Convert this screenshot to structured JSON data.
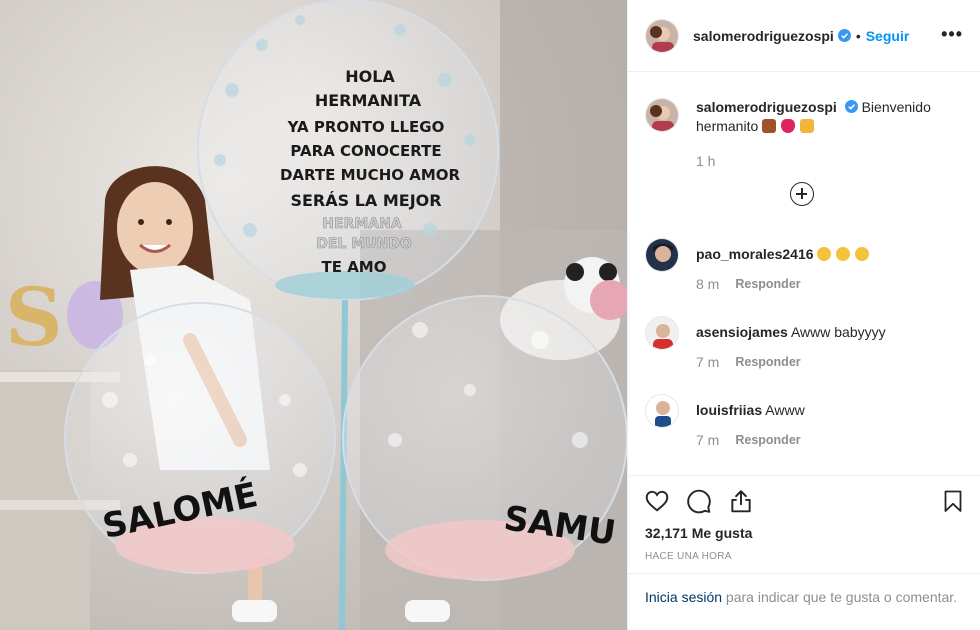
{
  "post": {
    "username": "salomerodriguezospi",
    "separator": "•",
    "follow_label": "Seguir",
    "more_label": "•••",
    "caption_text": "Bienvenido hermanito",
    "caption_time": "1 h",
    "balloon_text": {
      "lines": [
        "HOLA",
        "HERMANITA",
        "YA PRONTO LLEGO",
        "PARA CONOCERTE",
        "DARTE MUCHO AMOR",
        "SERÁS LA MEJOR",
        "HERMANA",
        "DEL MUNDO",
        "TE AMO"
      ],
      "left_name": "SALOMÉ",
      "right_name": "SAMU"
    }
  },
  "comments": [
    {
      "username": "pao_morales2416",
      "text": "",
      "time": "8 m",
      "reply_label": "Responder"
    },
    {
      "username": "asensiojames",
      "text": "Awww babyyyy",
      "time": "7 m",
      "reply_label": "Responder"
    },
    {
      "username": "louisfriias",
      "text": "Awww",
      "time": "7 m",
      "reply_label": "Responder"
    }
  ],
  "actions": {
    "likes": "32,171 Me gusta",
    "timestamp": "HACE UNA HORA",
    "icons": [
      "heart-icon",
      "comment-icon",
      "share-icon",
      "bookmark-icon"
    ]
  },
  "login": {
    "link": "Inicia sesión",
    "rest": " para indicar que te gusta o comentar."
  },
  "colors": {
    "link_blue": "#0095f6",
    "dark_link": "#00376b",
    "muted": "#8e8e8e",
    "border": "#efefef"
  }
}
